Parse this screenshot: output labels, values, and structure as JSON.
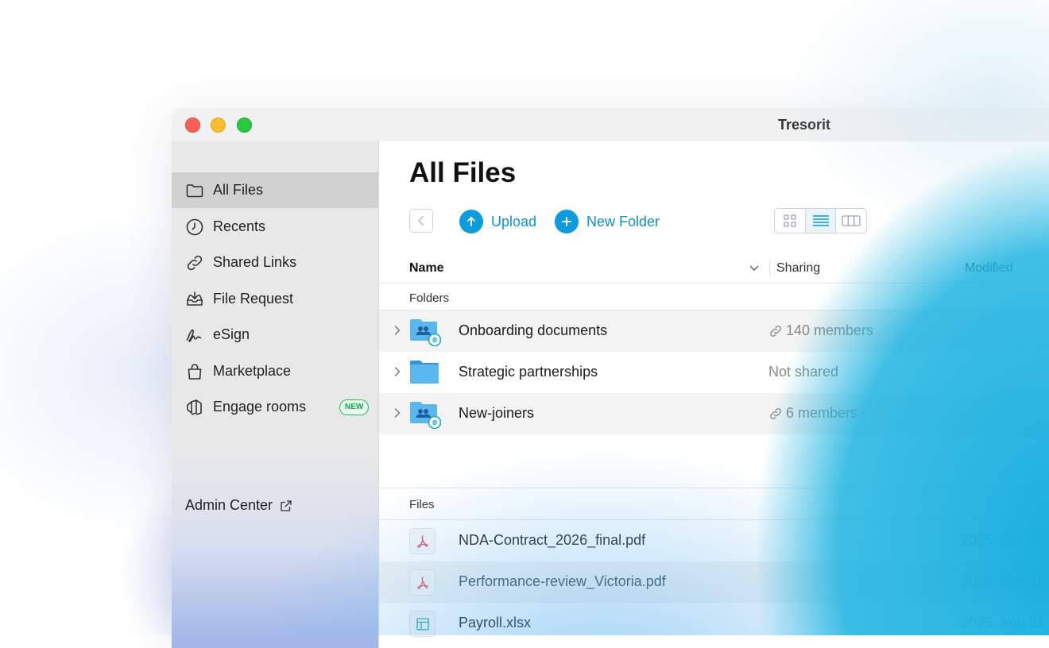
{
  "window": {
    "title": "Tresorit"
  },
  "sidebar": {
    "items": [
      {
        "label": "All Files",
        "icon": "folder-icon",
        "active": true
      },
      {
        "label": "Recents",
        "icon": "clock-icon"
      },
      {
        "label": "Shared Links",
        "icon": "link-icon"
      },
      {
        "label": "File Request",
        "icon": "inbox-download-icon"
      },
      {
        "label": "eSign",
        "icon": "signature-icon"
      },
      {
        "label": "Marketplace",
        "icon": "shopping-bag-icon"
      },
      {
        "label": "Engage rooms",
        "icon": "engage-rooms-icon",
        "badge": "NEW"
      }
    ],
    "admin_center": "Admin Center"
  },
  "main": {
    "title": "All Files",
    "toolbar": {
      "upload_label": "Upload",
      "new_folder_label": "New Folder",
      "view_mode": "list"
    },
    "columns": {
      "name": "Name",
      "sharing": "Sharing",
      "modified": "Modified"
    },
    "folders_label": "Folders",
    "folders": [
      {
        "name": "Onboarding documents",
        "sharing": "140 members",
        "shared": true
      },
      {
        "name": "Strategic partnerships",
        "sharing": "Not shared",
        "shared": false
      },
      {
        "name": "New-joiners",
        "sharing": "6 members",
        "shared": true
      }
    ],
    "files_label": "Files",
    "files": [
      {
        "name": "NDA-Contract_2026_final.pdf",
        "type": "pdf",
        "modified": "2025. Oct 2."
      },
      {
        "name": "Performance-review_Victoria.pdf",
        "type": "pdf",
        "modified": "2025. Sep 15"
      },
      {
        "name": "Payroll.xlsx",
        "type": "xlsx",
        "modified": "2025. Aug 21"
      }
    ]
  },
  "colors": {
    "accent": "#0b9bde",
    "badge_green": "#1fbf58",
    "folder_blue": "#5bb8ee"
  }
}
